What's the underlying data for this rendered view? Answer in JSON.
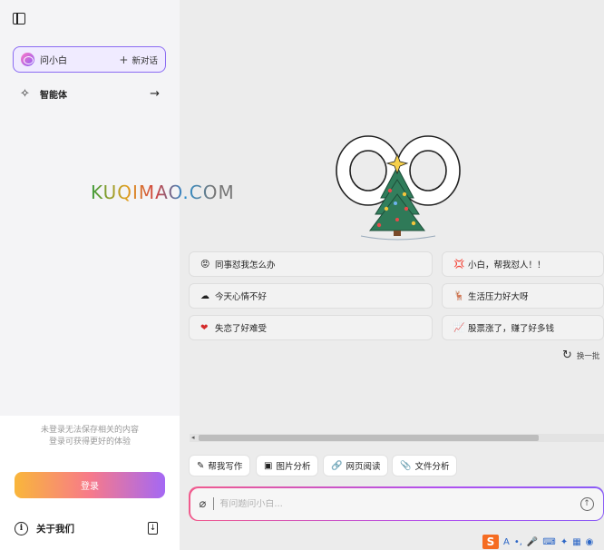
{
  "sidebar": {
    "chat_label": "问小白",
    "new_chat_label": "新对话",
    "agent_label": "智能体",
    "login_hint_line1": "未登录无法保存相关的内容",
    "login_hint_line2": "登录可获得更好的体验",
    "login_label": "登录",
    "about_label": "关于我们"
  },
  "watermark": {
    "text": "KUQIMAO.COM"
  },
  "suggestions": [
    {
      "icon": "😡",
      "label": "同事怼我怎么办"
    },
    {
      "icon": "💢",
      "label": "小白，帮我怼人！！"
    },
    {
      "icon": "☁",
      "label": "今天心情不好"
    },
    {
      "icon": "🦌",
      "label": "生活压力好大呀"
    },
    {
      "icon": "❤",
      "label": "失恋了好难受"
    },
    {
      "icon": "📈",
      "label": "股票涨了，赚了好多钱"
    }
  ],
  "refresh_label": "换一批",
  "tools": [
    {
      "icon": "✎",
      "label": "帮我写作"
    },
    {
      "icon": "▣",
      "label": "图片分析"
    },
    {
      "icon": "🔗",
      "label": "网页阅读"
    },
    {
      "icon": "📎",
      "label": "文件分析"
    }
  ],
  "input": {
    "placeholder": "有问题问小白..."
  },
  "colors": {
    "accent": "#8a5cf6",
    "login_gradient_start": "#f9b63b",
    "login_gradient_end": "#a468f4"
  }
}
